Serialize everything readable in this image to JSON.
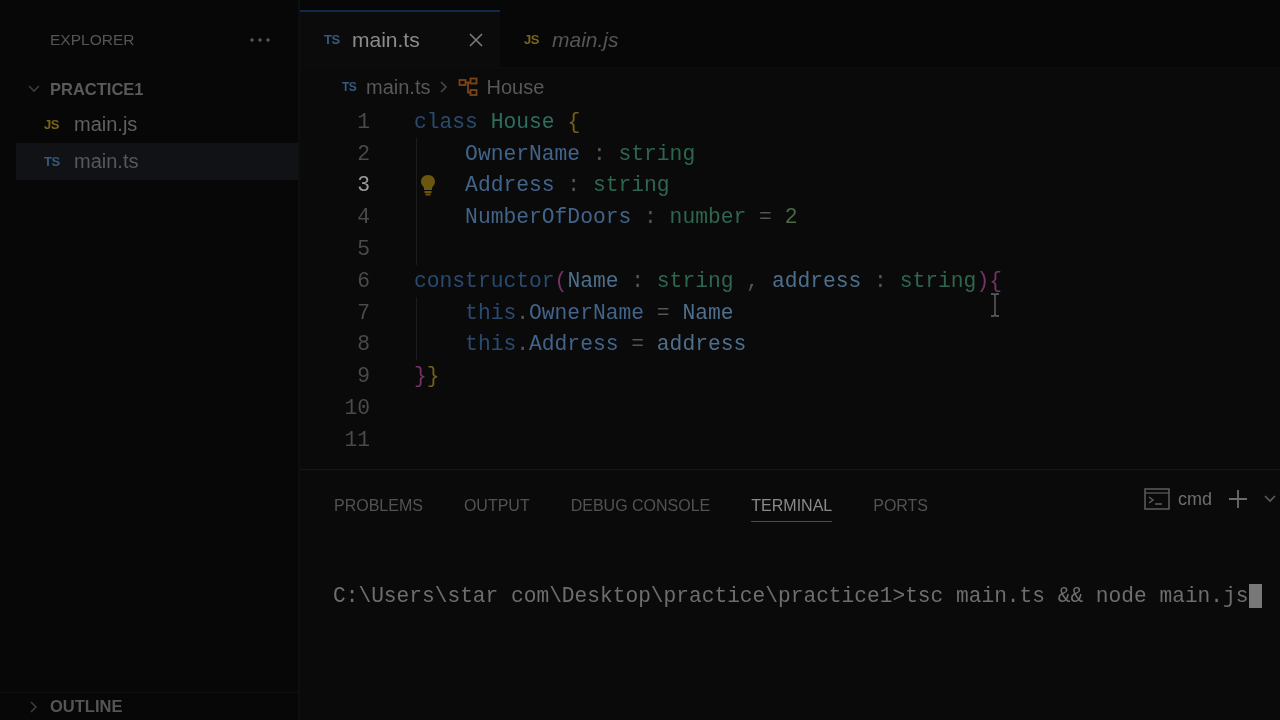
{
  "sidebar": {
    "title": "EXPLORER",
    "folder": {
      "name": "PRACTICE1",
      "expanded": true,
      "children": [
        {
          "name": "main.js",
          "badge": "JS",
          "kind": "js",
          "selected": false
        },
        {
          "name": "main.ts",
          "badge": "TS",
          "kind": "ts",
          "selected": true
        }
      ]
    },
    "outline": {
      "name": "OUTLINE",
      "expanded": false
    }
  },
  "tabs": [
    {
      "name": "main.ts",
      "badge": "TS",
      "kind": "ts",
      "selected": true,
      "preview": false
    },
    {
      "name": "main.js",
      "badge": "JS",
      "kind": "js",
      "selected": false,
      "preview": true
    }
  ],
  "breadcrumb": {
    "badge": "TS",
    "kind": "ts",
    "file": "main.ts",
    "symbol": "House"
  },
  "editor": {
    "lines": [
      {
        "number": "1",
        "current": false,
        "tokens": [
          {
            "text": "class ",
            "kind": "keyword"
          },
          {
            "text": "House ",
            "kind": "type"
          },
          {
            "text": "{",
            "kind": "bracket1"
          }
        ]
      },
      {
        "number": "2",
        "current": false,
        "tokens": [
          {
            "text": "    OwnerName",
            "kind": "prop"
          },
          {
            "text": " : ",
            "kind": "punct"
          },
          {
            "text": "string",
            "kind": "primitive"
          }
        ]
      },
      {
        "number": "3",
        "current": true,
        "tokens": [
          {
            "text": "    Address",
            "kind": "prop"
          },
          {
            "text": " : ",
            "kind": "punct"
          },
          {
            "text": "string",
            "kind": "primitive"
          }
        ]
      },
      {
        "number": "4",
        "current": false,
        "tokens": [
          {
            "text": "    NumberOfDoors",
            "kind": "prop"
          },
          {
            "text": " : ",
            "kind": "punct"
          },
          {
            "text": "number",
            "kind": "primitive"
          },
          {
            "text": " = ",
            "kind": "punct"
          },
          {
            "text": "2",
            "kind": "numeric"
          }
        ]
      },
      {
        "number": "5",
        "current": false
      },
      {
        "number": "6",
        "current": false,
        "tokens": [
          {
            "text": "constructor",
            "kind": "keyword"
          },
          {
            "text": "(",
            "kind": "bracket2"
          },
          {
            "text": "Name",
            "kind": "param"
          },
          {
            "text": " : ",
            "kind": "punct"
          },
          {
            "text": "string",
            "kind": "primitive"
          },
          {
            "text": " , ",
            "kind": "punct"
          },
          {
            "text": "address",
            "kind": "param"
          },
          {
            "text": " : ",
            "kind": "punct"
          },
          {
            "text": "string",
            "kind": "primitive"
          },
          {
            "text": ")",
            "kind": "bracket2"
          },
          {
            "text": "{",
            "kind": "bracket2"
          }
        ]
      },
      {
        "number": "7",
        "current": false,
        "tokens": [
          {
            "text": "    this",
            "kind": "keyword"
          },
          {
            "text": ".",
            "kind": "punct"
          },
          {
            "text": "OwnerName",
            "kind": "prop"
          },
          {
            "text": " = ",
            "kind": "punct"
          },
          {
            "text": "Name",
            "kind": "param"
          }
        ]
      },
      {
        "number": "8",
        "current": false,
        "tokens": [
          {
            "text": "    this",
            "kind": "keyword"
          },
          {
            "text": ".",
            "kind": "punct"
          },
          {
            "text": "Address",
            "kind": "prop"
          },
          {
            "text": " = ",
            "kind": "punct"
          },
          {
            "text": "address",
            "kind": "param"
          }
        ]
      },
      {
        "number": "9",
        "current": false,
        "tokens": [
          {
            "text": "}",
            "kind": "bracket2"
          },
          {
            "text": "}",
            "kind": "bracket1"
          }
        ]
      },
      {
        "number": "10",
        "current": false
      },
      {
        "number": "11",
        "current": false
      }
    ]
  },
  "panel": {
    "tabs": [
      {
        "label": "PROBLEMS",
        "selected": false
      },
      {
        "label": "OUTPUT",
        "selected": false
      },
      {
        "label": "DEBUG CONSOLE",
        "selected": false
      },
      {
        "label": "TERMINAL",
        "selected": true
      },
      {
        "label": "PORTS",
        "selected": false
      }
    ],
    "profile": "cmd",
    "terminal_lines": [
      "C:\\Users\\star com\\Desktop\\practice\\practice1>tsc main.ts && node main.js"
    ]
  }
}
